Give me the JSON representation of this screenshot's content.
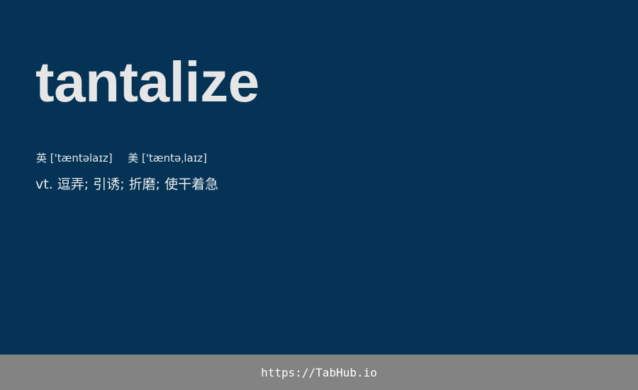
{
  "card": {
    "word": "tantalize",
    "phonetic_uk_label": "英",
    "phonetic_uk": "['tæntəlaɪz]",
    "phonetic_us_label": "美",
    "phonetic_us": "['tæntəˌlaɪz]",
    "part_of_speech": "vt.",
    "meaning": "逗弄; 引诱; 折磨; 使干着急"
  },
  "footer": {
    "url": "https://TabHub.io"
  },
  "colors": {
    "background": "#043356",
    "footer": "#838383",
    "word": "#e6e6e6"
  }
}
